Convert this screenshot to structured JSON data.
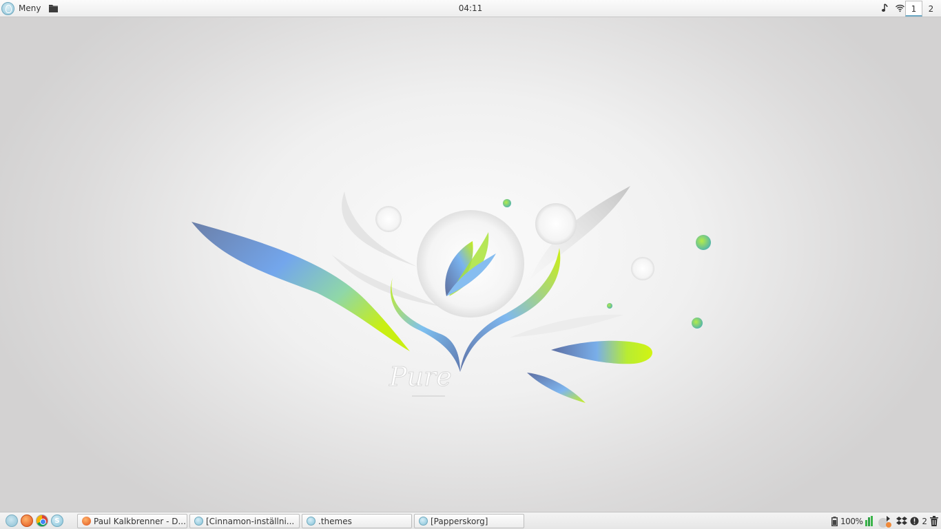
{
  "top_panel": {
    "menu_label": "Meny",
    "clock": "04:11",
    "workspaces": [
      "1",
      "2"
    ],
    "active_workspace": "1",
    "icons": [
      "menu-logo-icon",
      "folder-icon",
      "music-note-icon",
      "wifi-icon"
    ]
  },
  "desktop": {
    "wallpaper_text": "Pure",
    "wallpaper_colors": {
      "blue": "#6f9fe0",
      "green": "#c8ef1a",
      "grey": "#cfcfcf"
    }
  },
  "bottom_panel": {
    "launchers": [
      "menu-launcher-icon",
      "firefox-icon",
      "chrome-icon",
      "skype-icon"
    ],
    "tasks": [
      {
        "label": "Paul Kalkbrenner - D...",
        "icon": "firefox-icon"
      },
      {
        "label": "[Cinnamon-inställni...",
        "icon": "cinnamon-settings-icon"
      },
      {
        "label": ".themes",
        "icon": "folder-icon"
      },
      {
        "label": "[Papperskorg]",
        "icon": "trash-folder-icon"
      }
    ],
    "tray": {
      "battery": "100%",
      "notification_count": "2",
      "icons": [
        "battery-icon",
        "system-monitor-icon",
        "weather-icon",
        "dropbox-icon",
        "notification-icon",
        "trash-icon"
      ]
    }
  }
}
